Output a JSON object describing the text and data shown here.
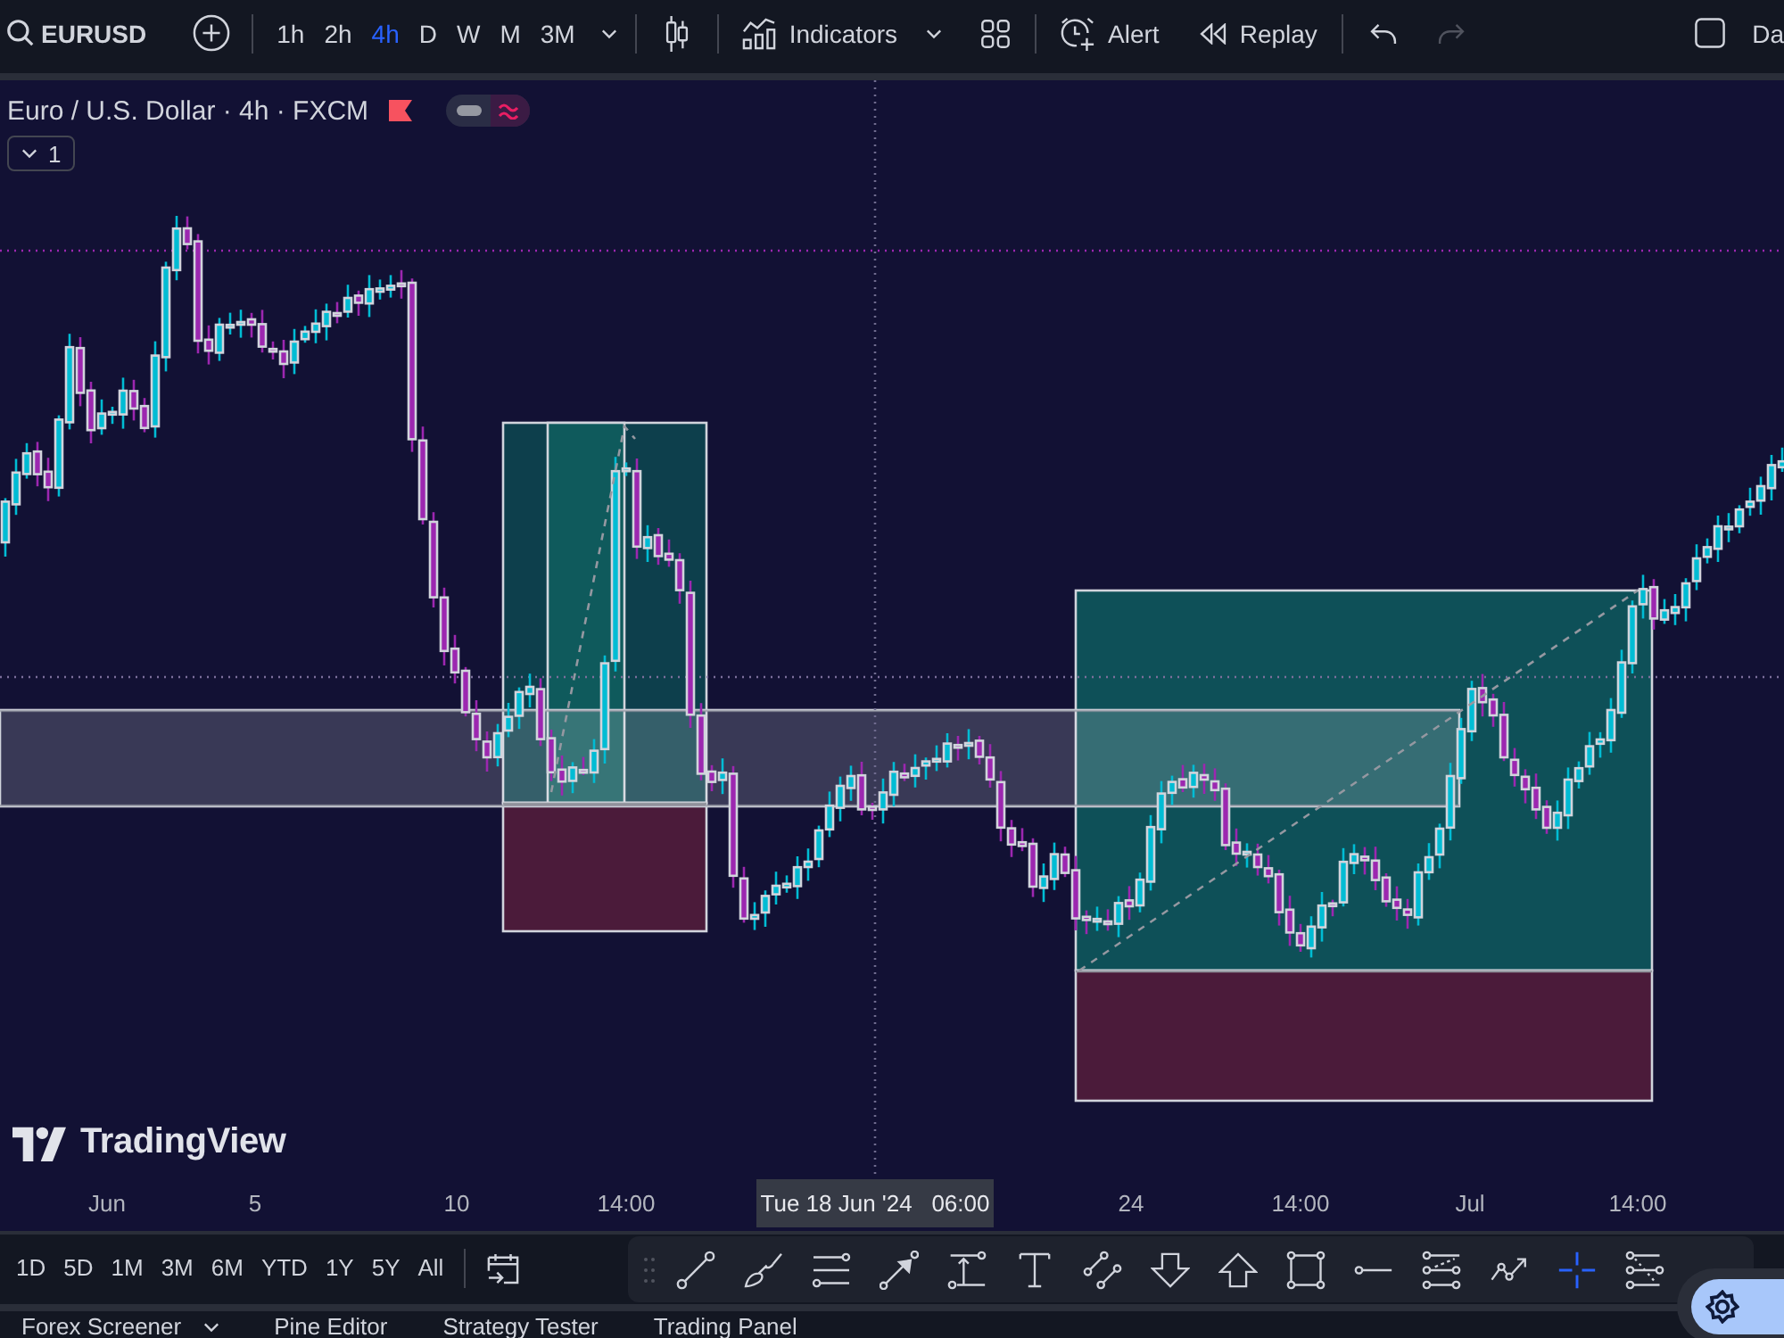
{
  "toolbar": {
    "symbol": "EURUSD",
    "intervals": [
      {
        "label": "1h",
        "selected": false
      },
      {
        "label": "2h",
        "selected": false
      },
      {
        "label": "4h",
        "selected": true
      },
      {
        "label": "D",
        "selected": false
      },
      {
        "label": "W",
        "selected": false
      },
      {
        "label": "M",
        "selected": false
      },
      {
        "label": "3M",
        "selected": false
      }
    ],
    "indicators": "Indicators",
    "alert": "Alert",
    "replay": "Replay",
    "undo": {
      "disabled": false
    },
    "redo": {
      "disabled": true
    },
    "cut_label": "Da"
  },
  "legend": {
    "title": "Euro / U.S. Dollar · 4h · FXCM",
    "collapse_count": "1"
  },
  "chart": {
    "logo": "TradingView"
  },
  "time_axis": {
    "labels": [
      "Jun",
      "5",
      "10",
      "14:00",
      "24",
      "14:00",
      "Jul",
      "14:00"
    ],
    "crosshair_label": "Tue 18 Jun '24   06:00"
  },
  "ranges": [
    "1D",
    "5D",
    "1M",
    "3M",
    "6M",
    "YTD",
    "1Y",
    "5Y",
    "All"
  ],
  "drawing_tools": [
    {
      "kind": "trendline",
      "selected": false
    },
    {
      "kind": "brush",
      "selected": false
    },
    {
      "kind": "channel",
      "selected": false
    },
    {
      "kind": "arrow",
      "selected": false
    },
    {
      "kind": "pricerange",
      "selected": false
    },
    {
      "kind": "text",
      "selected": false
    },
    {
      "kind": "segments",
      "selected": false
    },
    {
      "kind": "arrowdown",
      "selected": false
    },
    {
      "kind": "arrowup",
      "selected": false
    },
    {
      "kind": "rectangle",
      "selected": false
    },
    {
      "kind": "ray",
      "selected": false
    },
    {
      "kind": "fibchannel",
      "selected": false
    },
    {
      "kind": "path",
      "selected": false
    },
    {
      "kind": "crosshair",
      "selected": true
    },
    {
      "kind": "fibtime",
      "selected": false
    }
  ],
  "bottom_tabs": [
    {
      "label": "Forex Screener",
      "menu": true
    },
    {
      "label": "Pine Editor",
      "menu": false
    },
    {
      "label": "Strategy Tester",
      "menu": false
    },
    {
      "label": "Trading Panel",
      "menu": false
    }
  ]
}
